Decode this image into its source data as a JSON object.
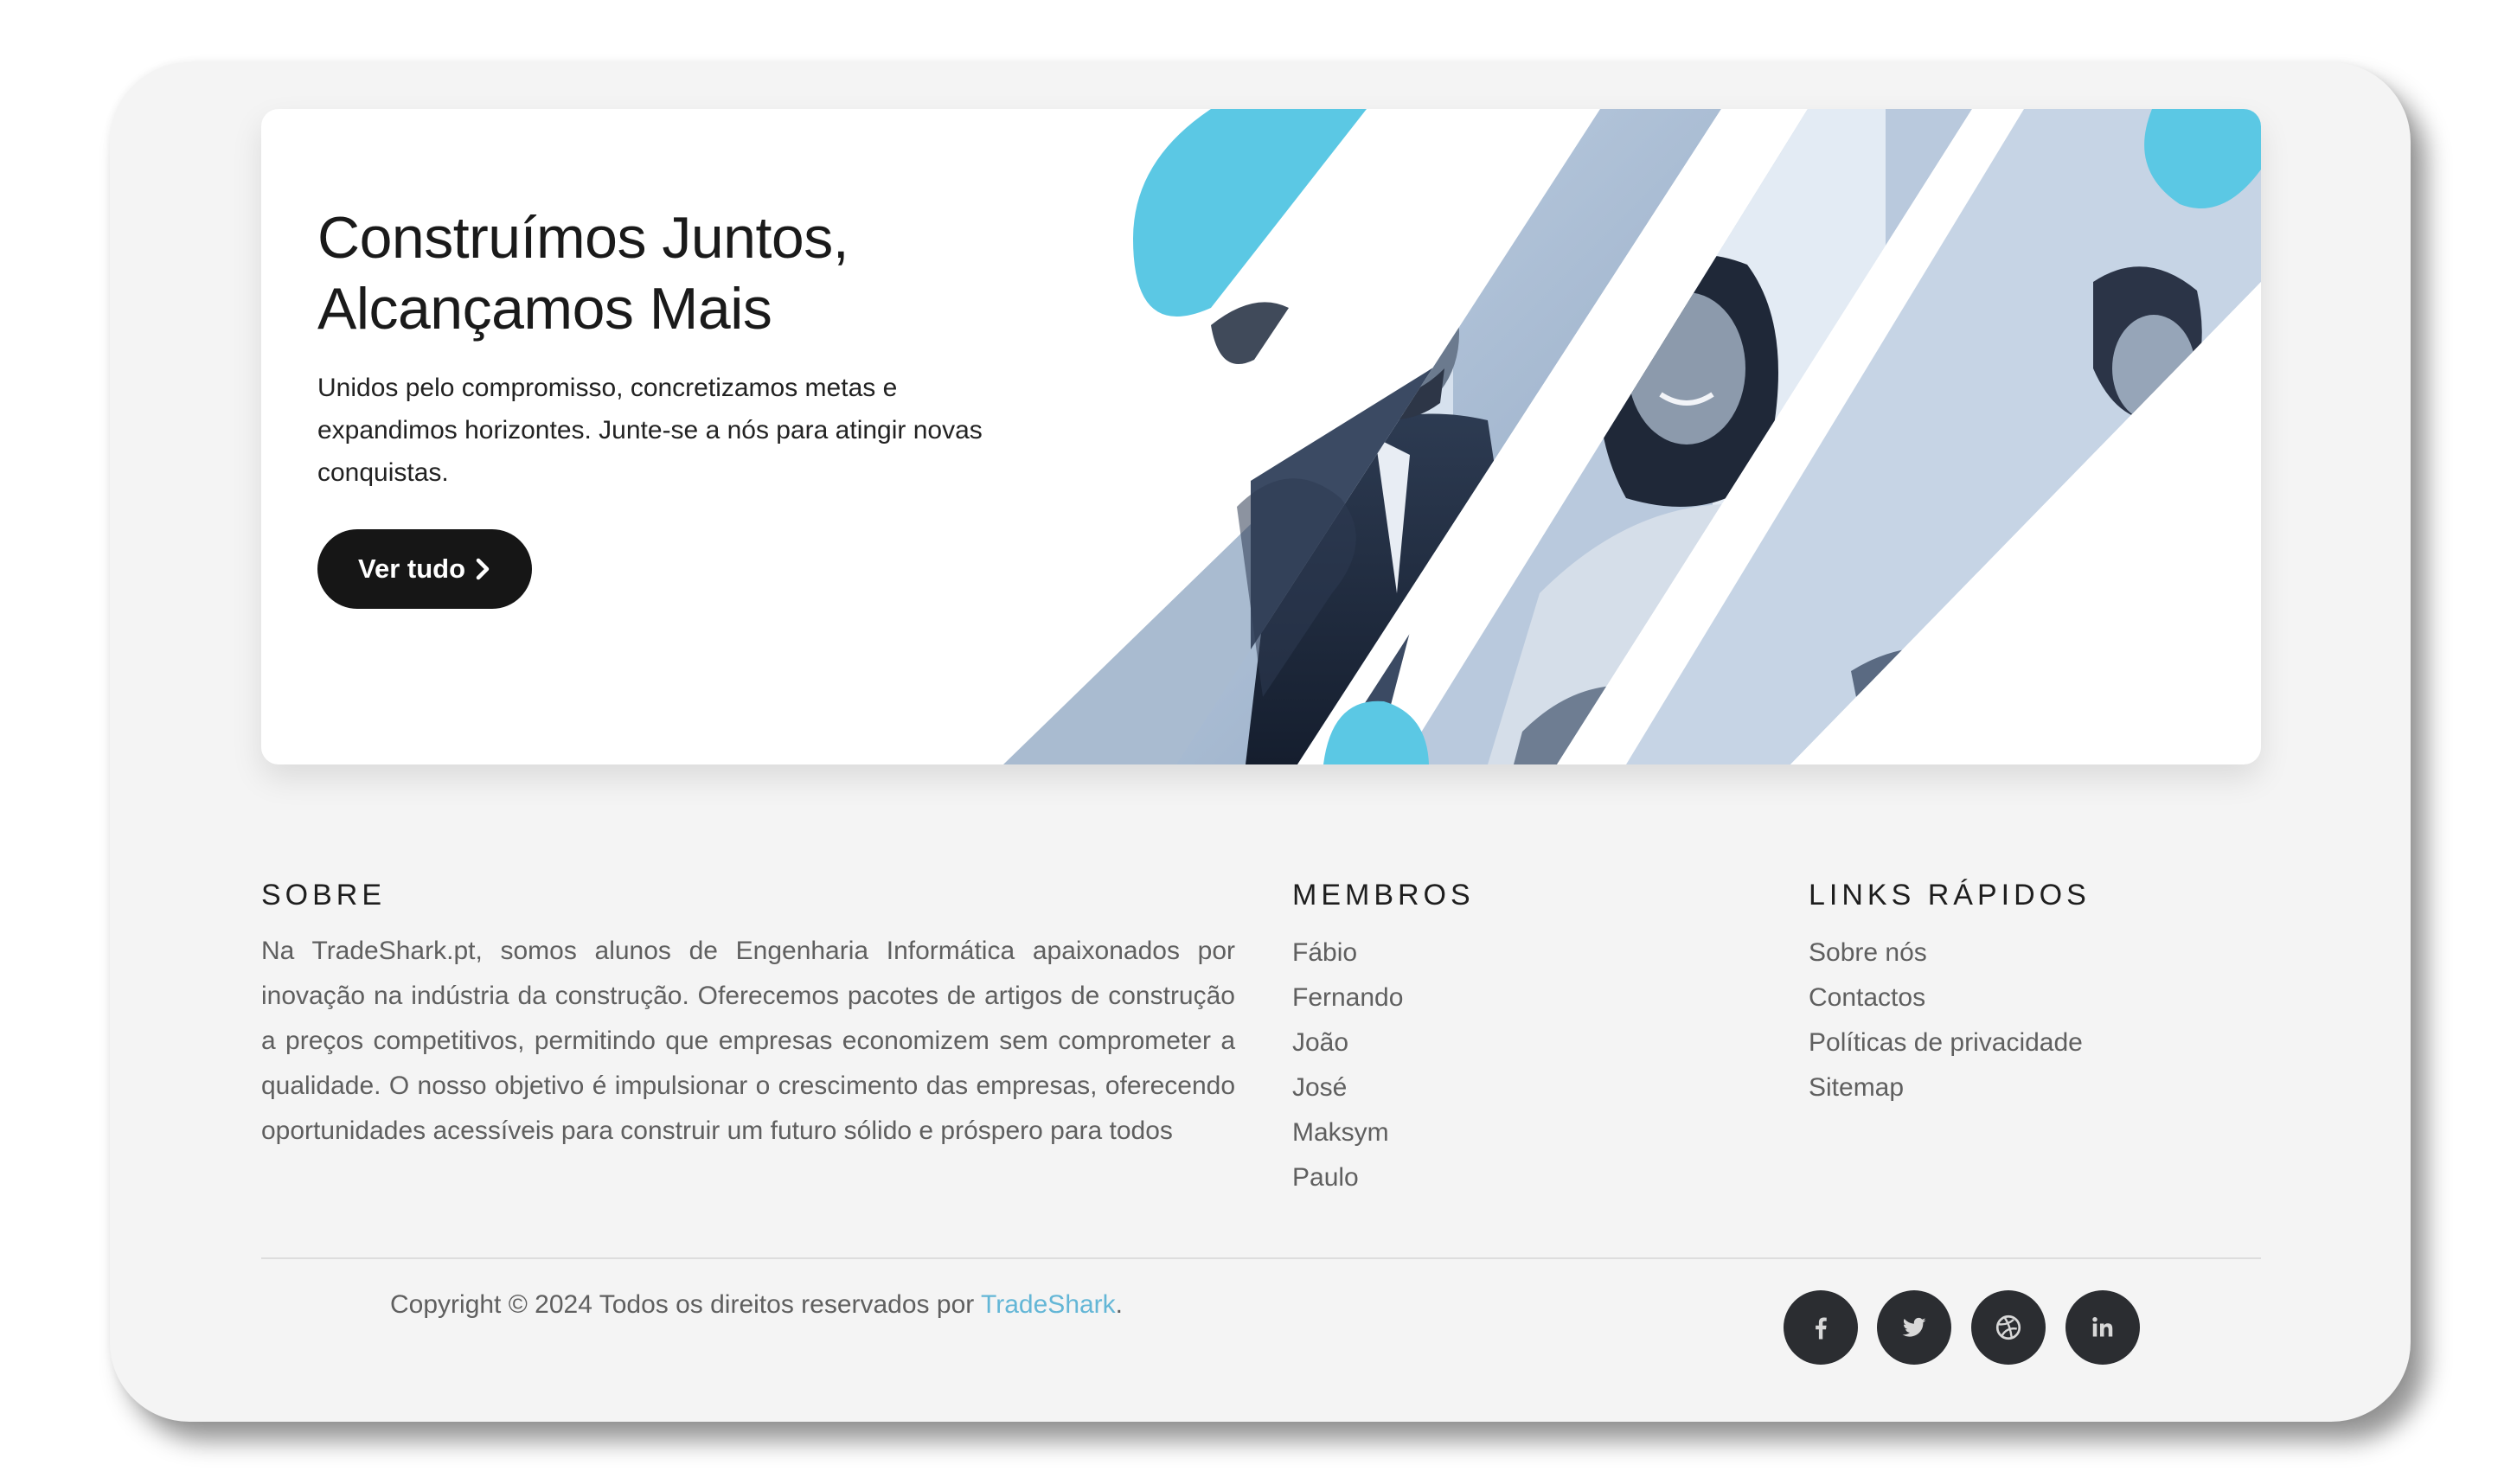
{
  "hero": {
    "title_line1": "Construímos Juntos,",
    "title_line2": "Alcançamos Mais",
    "text": "Unidos pelo compromisso, concretizamos metas e expandimos horizontes. Junte-se a nós para atingir novas conquistas.",
    "button_label": "Ver tudo",
    "button_icon": "chevron-right-icon",
    "image": "business-handshake-photo",
    "accent_color": "#5bc8e4"
  },
  "about": {
    "title": "SOBRE",
    "text": "Na TradeShark.pt, somos alunos de Engenharia Informática apaixonados por inovação na indústria da construção. Oferecemos pacotes de artigos de construção a preços competitivos, permitindo que empresas economizem sem comprometer a qualidade. O nosso objetivo é impulsionar o crescimento das empresas, oferecendo oportunidades acessíveis para construir um futuro sólido e próspero para todos"
  },
  "members": {
    "title": "MEMBROS",
    "items": [
      "Fábio",
      "Fernando",
      "João",
      "José",
      "Maksym",
      "Paulo"
    ]
  },
  "quick_links": {
    "title": "LINKS RÁPIDOS",
    "items": [
      "Sobre nós",
      "Contactos",
      "Políticas de privacidade",
      "Sitemap"
    ]
  },
  "footer": {
    "copyright_text": "Copyright © 2024 Todos os direitos reservados por ",
    "brand_link": "TradeShark",
    "copyright_end": ".",
    "link_color": "#63b6d6",
    "social_icons": [
      "facebook-icon",
      "twitter-icon",
      "dribbble-icon",
      "linkedin-icon"
    ]
  }
}
